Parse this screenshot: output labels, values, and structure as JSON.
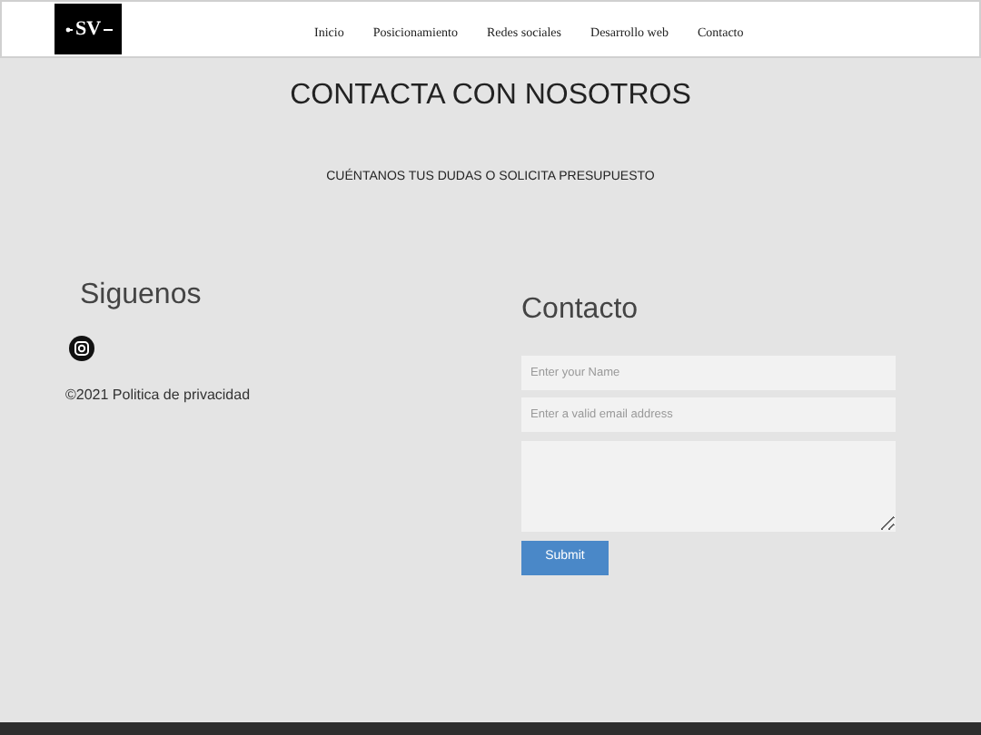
{
  "header": {
    "logo_text": "SV",
    "nav": [
      {
        "label": "Inicio"
      },
      {
        "label": "Posicionamiento"
      },
      {
        "label": "Redes sociales"
      },
      {
        "label": "Desarrollo web"
      },
      {
        "label": "Contacto"
      }
    ]
  },
  "title": "CONTACTA CON NOSOTROS",
  "subtitle": "CUÉNTANOS TUS DUDAS O SOLICITA PRESUPUESTO",
  "social": {
    "heading": "Siguenos",
    "copyright": "©2021 Politica de privacidad"
  },
  "contact": {
    "heading": "Contacto",
    "name_placeholder": "Enter your Name",
    "email_placeholder": "Enter a valid email address",
    "submit": "Submit"
  }
}
